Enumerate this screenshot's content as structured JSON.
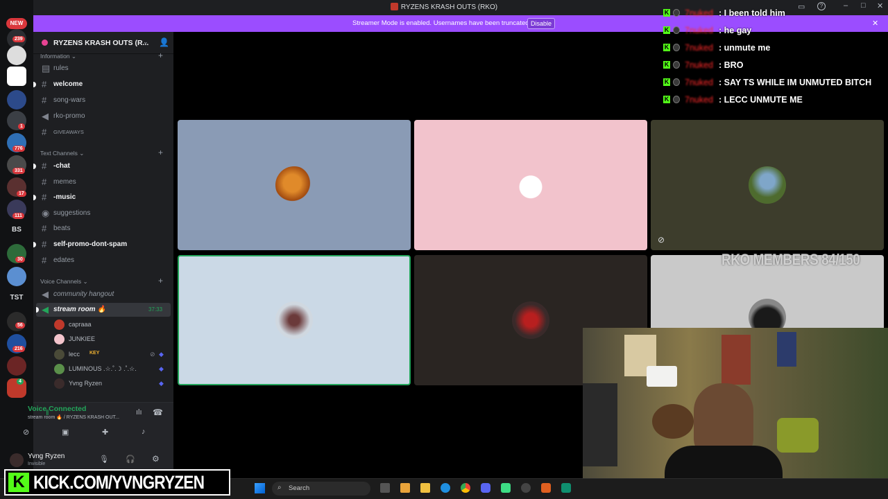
{
  "titlebar": {
    "title": "RYZENS KRASH OUTS (RKO)"
  },
  "banner": {
    "text": "Streamer Mode is enabled. Usernames have been truncated.",
    "button": "Disable"
  },
  "server_rail": {
    "new_badge": "NEW",
    "badges": [
      "239",
      "1",
      "776",
      "331",
      "17",
      "111",
      "30",
      "56",
      "216",
      "4"
    ],
    "text_servers": [
      "BS",
      "TST"
    ]
  },
  "server": {
    "name": "RYZENS KRASH OUTS (R..."
  },
  "categories": {
    "information": "Information",
    "text": "Text Channels",
    "voice": "Voice Channels"
  },
  "info_channels": [
    {
      "label": "rules"
    },
    {
      "label": "welcome"
    },
    {
      "label": "song-wars"
    },
    {
      "label": "rko-promo"
    },
    {
      "label": "GIVEAWAYS"
    }
  ],
  "text_channels": [
    {
      "label": "-chat"
    },
    {
      "label": "memes"
    },
    {
      "label": "-music"
    },
    {
      "label": "suggestions"
    },
    {
      "label": "beats"
    },
    {
      "label": "self-promo-dont-spam"
    },
    {
      "label": "edates"
    }
  ],
  "voice_channels": [
    {
      "label": "community hangout"
    },
    {
      "label": "stream room 🔥",
      "timer": "37:33"
    }
  ],
  "voice_members": [
    {
      "name": "capraaa",
      "color": "#c0392b"
    },
    {
      "name": "JUNKIEE",
      "color": "#f3c4cc"
    },
    {
      "name": "lecc",
      "tag": "KEY",
      "color": "#3b3b2e"
    },
    {
      "name": "LUMINOUS .☆.˚.☽ .˚.☆.",
      "color": "#c9d6e3"
    },
    {
      "name": "Yvng Ryzen",
      "color": "#3a2b2b"
    }
  ],
  "voice_status": {
    "title": "Voice Connected",
    "subtitle": "stream room 🔥 / RYZENS KRASH OUT..."
  },
  "user": {
    "name": "Yvng Ryzen",
    "status": "Invisible"
  },
  "tiles": [
    {
      "bg": "#8a9bb5",
      "avatar": "monkey"
    },
    {
      "bg": "#f2c3cc",
      "avatar": "cat"
    },
    {
      "bg": "#3d3d2c",
      "avatar": "outdoor"
    },
    {
      "bg": "#cbd9e6",
      "avatar": "character"
    },
    {
      "bg": "#2a2522",
      "avatar": "dark-figure"
    },
    {
      "bg": "#c9c9c9",
      "avatar": "dark-silhouette"
    }
  ],
  "chat": [
    {
      "user": "7nuked",
      "message": ": I been told him"
    },
    {
      "user": "7nuked",
      "message": ": he gay"
    },
    {
      "user": "7nuked",
      "message": ": unmute me"
    },
    {
      "user": "7nuked",
      "message": ": BRO"
    },
    {
      "user": "7nuked",
      "message": ": SAY TS WHILE IM UNMUTED BITCH"
    },
    {
      "user": "7nuked",
      "message": ": LECC UNMUTE ME"
    }
  ],
  "overlay": {
    "members": "RKO MEMBERS 84/150",
    "kick_url": "KICK.COM/YVNGRYZEN"
  },
  "taskbar": {
    "search": "Search"
  },
  "colors": {
    "accent": "#9b4dff",
    "kick": "#53fc18",
    "voice_green": "#23a55a"
  }
}
